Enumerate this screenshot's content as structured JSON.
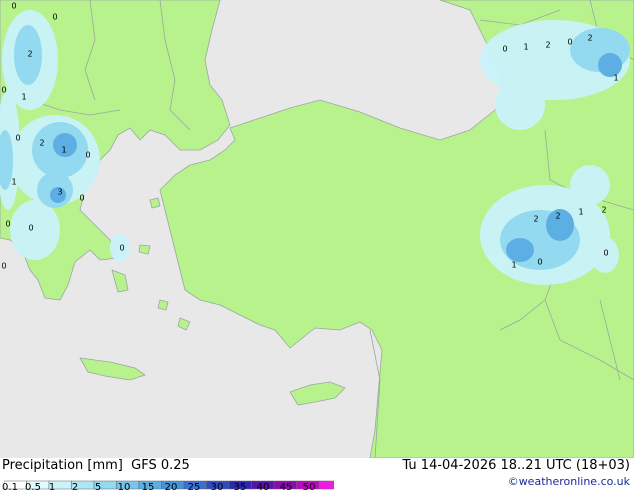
{
  "map": {
    "precip_labels": [
      "0",
      "0",
      "2",
      "1",
      "0",
      "2",
      "1",
      "0",
      "0",
      "3",
      "0",
      "1",
      "0",
      "0",
      "0",
      "0",
      "0",
      "1",
      "2",
      "0",
      "2",
      "1",
      "2",
      "2",
      "1",
      "2",
      "1",
      "0",
      "0"
    ]
  },
  "footer": {
    "title": "Precipitation [mm]  GFS 0.25",
    "valid_time": "Tu 14-04-2026 18..21 UTC (18+03)",
    "credit": "©weatheronline.co.uk"
  },
  "legend": {
    "ticks": [
      "0.1",
      "0.5",
      "1",
      "2",
      "5",
      "10",
      "15",
      "20",
      "25",
      "30",
      "35",
      "40",
      "45",
      "50"
    ],
    "colors": [
      "#ffffff",
      "#e4fbfd",
      "#c9f3f9",
      "#aee7f4",
      "#93d9f0",
      "#78c4ea",
      "#5daee3",
      "#4593dc",
      "#3a6fd4",
      "#3048c2",
      "#2b27ae",
      "#5414a8",
      "#8a09b2",
      "#c005c0",
      "#f01ae8"
    ]
  },
  "colors": {
    "land": "#b7f28c",
    "sea": "#e8e8e8",
    "border": "#9aa8a0"
  }
}
